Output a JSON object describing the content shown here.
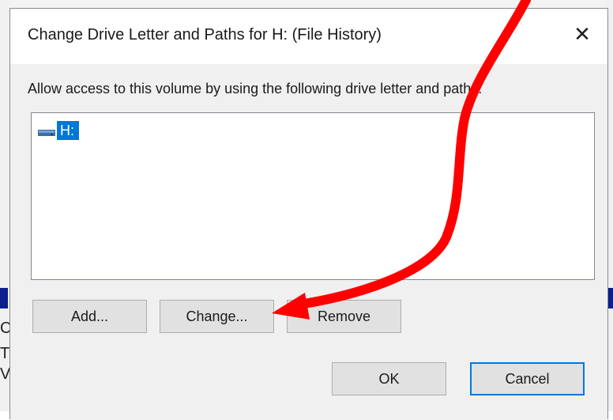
{
  "dialog": {
    "title": "Change Drive Letter and Paths for H: (File History)",
    "close_glyph": "✕",
    "description": "Allow access to this volume by using the following drive letter and paths:",
    "list_items": [
      {
        "label": "H:",
        "icon": "drive-icon",
        "selected": true
      }
    ],
    "buttons": {
      "add": "Add...",
      "change": "Change...",
      "remove": "Remove",
      "ok": "OK",
      "cancel": "Cancel"
    }
  },
  "background": {
    "glyphs": [
      "C",
      "T",
      "V"
    ]
  },
  "annotation": {
    "color": "#ff0000",
    "points_to": "change-button"
  },
  "colors": {
    "selection": "#0078d7",
    "default_button_border": "#0078d7",
    "background_bar": "#0c1f8c"
  }
}
